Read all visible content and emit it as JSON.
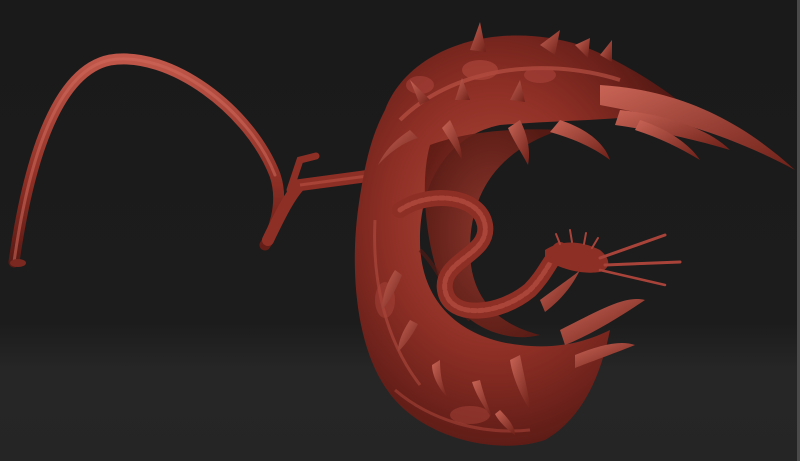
{
  "scene": {
    "subject": "sculpted-creature-render",
    "colors": {
      "background": "#1b1b1b",
      "floor": "#262626",
      "material_base": "#8e2f25",
      "material_highlight": "#c0574a",
      "material_shadow": "#4a1410"
    }
  }
}
